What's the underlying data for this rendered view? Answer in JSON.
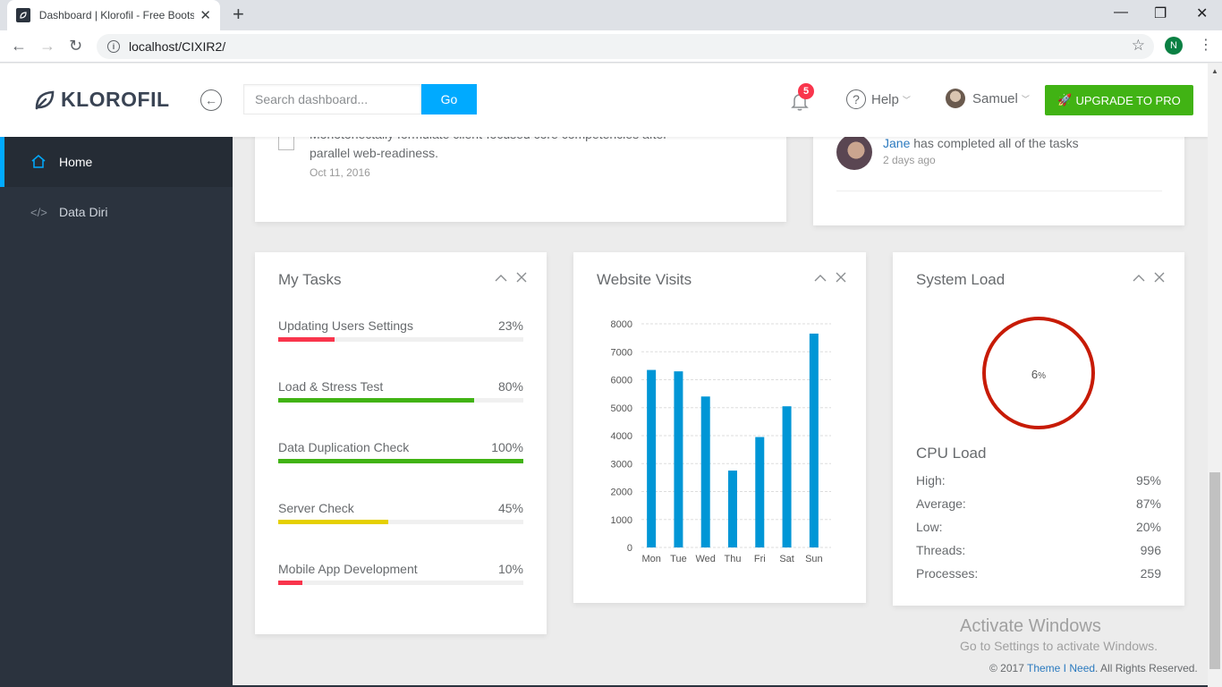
{
  "browser": {
    "tab_title": "Dashboard | Klorofil - Free Bootstrap",
    "tab_close": "✕",
    "new_tab": "+",
    "url": "localhost/CIXIR2/",
    "profile_initial": "N",
    "window_controls": [
      "—",
      "❐",
      "✕"
    ]
  },
  "header": {
    "brand": "KLOROFIL",
    "search": {
      "placeholder": "Search dashboard...",
      "button": "Go"
    },
    "notifications": {
      "count": "5"
    },
    "help": "Help",
    "user": "Samuel",
    "upgrade": "UPGRADE TO PRO"
  },
  "sidebar": {
    "items": [
      {
        "label": "Home",
        "icon": "home-icon",
        "active": true
      },
      {
        "label": "Data Diri",
        "icon": "code-icon",
        "active": false
      }
    ]
  },
  "todo": {
    "text": "Monotonectally formulate client-focused core competencies after parallel web-readiness.",
    "date": "Oct 11, 2016"
  },
  "activity": {
    "who": "Jane",
    "text": " has completed all of the tasks",
    "time": "2 days ago"
  },
  "tasks": {
    "title": "My Tasks",
    "items": [
      {
        "name": "Updating Users Settings",
        "pct": "23%",
        "value": 0.23,
        "color": "#f9354c"
      },
      {
        "name": "Load & Stress Test",
        "pct": "80%",
        "value": 0.8,
        "color": "#41b314"
      },
      {
        "name": "Data Duplication Check",
        "pct": "100%",
        "value": 1.0,
        "color": "#41b314"
      },
      {
        "name": "Server Check",
        "pct": "45%",
        "value": 0.45,
        "color": "#e5d000"
      },
      {
        "name": "Mobile App Development",
        "pct": "10%",
        "value": 0.1,
        "color": "#f9354c"
      }
    ]
  },
  "visits": {
    "title": "Website Visits",
    "chart_data": {
      "type": "bar",
      "categories": [
        "Mon",
        "Tue",
        "Wed",
        "Thu",
        "Fri",
        "Sat",
        "Sun"
      ],
      "values": [
        6350,
        6300,
        5400,
        2750,
        3950,
        5050,
        7650
      ],
      "yticks": [
        0,
        1000,
        2000,
        3000,
        4000,
        5000,
        6000,
        7000,
        8000
      ],
      "ylim": [
        0,
        8000
      ],
      "bar_color": "#0096d6",
      "grid": "dashed horizontal"
    }
  },
  "system": {
    "title": "System Load",
    "cpu_value": "6",
    "cpu_unit": "%",
    "cpu_title": "CPU Load",
    "stats": [
      {
        "label": "High:",
        "value": "95%"
      },
      {
        "label": "Average:",
        "value": "87%"
      },
      {
        "label": "Low:",
        "value": "20%"
      },
      {
        "label": "Threads:",
        "value": "996"
      },
      {
        "label": "Processes:",
        "value": "259"
      }
    ]
  },
  "watermark": {
    "line1": "Activate Windows",
    "line2": "Go to Settings to activate Windows."
  },
  "footer": {
    "prefix": "© 2017 ",
    "link": "Theme I Need",
    "suffix": ". All Rights Reserved."
  }
}
